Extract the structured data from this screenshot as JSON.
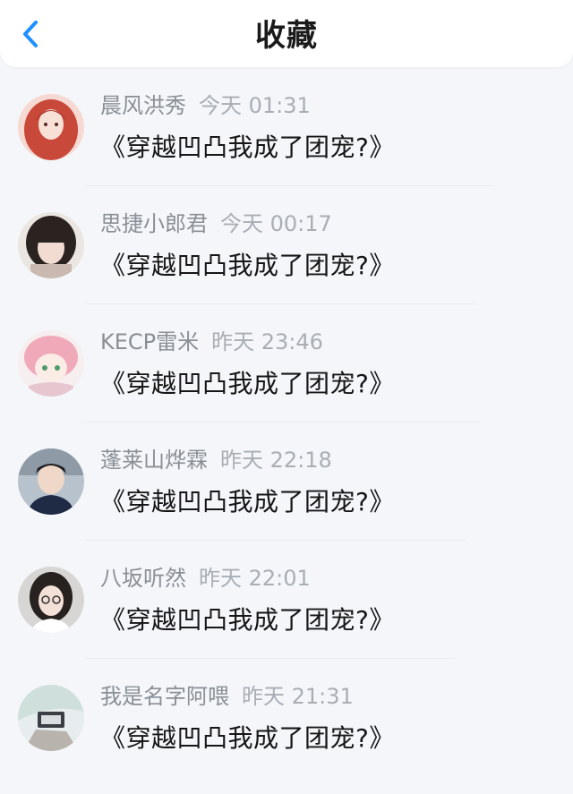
{
  "header": {
    "title": "收藏",
    "back_icon": "chevron-left-icon",
    "accent": "#1e90ff"
  },
  "messages": [
    {
      "name": "晨风洪秀",
      "time": "今天 01:31",
      "text": "《穿越凹凸我成了团宠?》"
    },
    {
      "name": "思捷小郎君",
      "time": "今天 00:17",
      "text": "《穿越凹凸我成了团宠?》"
    },
    {
      "name": "KECP雷米",
      "time": "昨天 23:46",
      "text": "《穿越凹凸我成了团宠?》"
    },
    {
      "name": "蓬莱山烨霖",
      "time": "昨天 22:18",
      "text": "《穿越凹凸我成了团宠?》"
    },
    {
      "name": "八坂听然",
      "time": "昨天 22:01",
      "text": "《穿越凹凸我成了团宠?》"
    },
    {
      "name": "我是名字阿喂",
      "time": "昨天 21:31",
      "text": "《穿越凹凸我成了团宠?》"
    }
  ]
}
